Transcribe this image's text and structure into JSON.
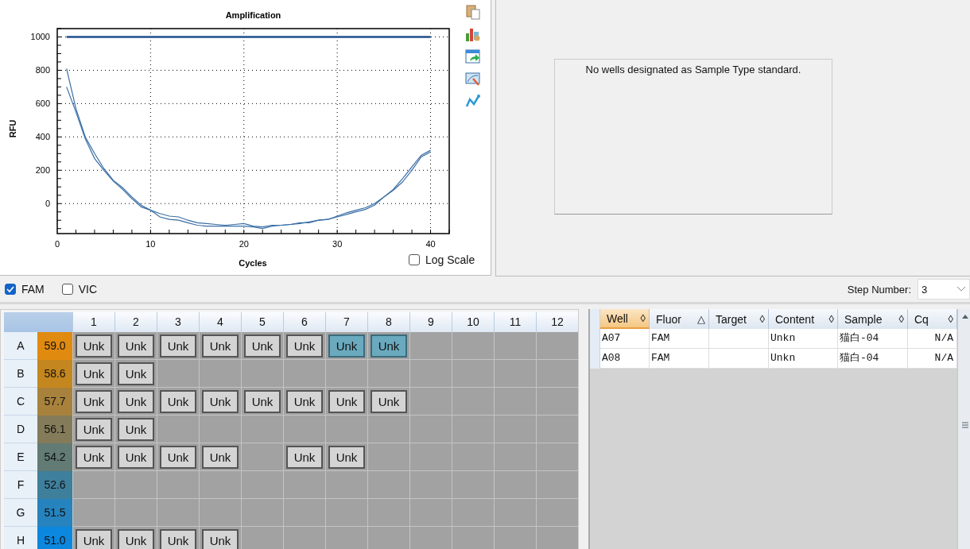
{
  "chart_panel": {
    "chart_data": {
      "type": "line",
      "grid": true,
      "title": "Amplification",
      "xlabel": "Cycles",
      "ylabel": "RFU",
      "xlim": [
        0,
        42
      ],
      "ylim": [
        -180,
        1050
      ],
      "xticks": [
        0,
        10,
        20,
        30,
        40
      ],
      "yticks": [
        0,
        200,
        400,
        600,
        800,
        1000
      ],
      "x": [
        1,
        2,
        3,
        4,
        5,
        6,
        7,
        8,
        9,
        10,
        11,
        12,
        13,
        14,
        15,
        16,
        17,
        18,
        19,
        20,
        21,
        22,
        23,
        24,
        25,
        26,
        27,
        28,
        29,
        30,
        31,
        32,
        33,
        34,
        35,
        36,
        37,
        38,
        39,
        40
      ],
      "series": [
        {
          "color": "#1f4e8c",
          "values": [
            1000,
            1000,
            1000,
            1000,
            1000,
            1000,
            1000,
            1000,
            1000,
            1000,
            1000,
            1000,
            1000,
            1000,
            1000,
            1000,
            1000,
            1000,
            1000,
            1000,
            1000,
            1000,
            1000,
            1000,
            1000,
            1000,
            1000,
            1000,
            1000,
            1000,
            1000,
            1000,
            1000,
            1000,
            1000,
            1000,
            1000,
            1000,
            1000,
            1000
          ]
        },
        {
          "color": "#3a6ea5",
          "values": [
            810,
            570,
            400,
            300,
            210,
            140,
            95,
            40,
            -10,
            -40,
            -80,
            -95,
            -100,
            -115,
            -130,
            -135,
            -135,
            -135,
            -135,
            -135,
            -140,
            -150,
            -135,
            -130,
            -125,
            -115,
            -115,
            -100,
            -95,
            -75,
            -55,
            -40,
            -25,
            0,
            40,
            80,
            130,
            200,
            280,
            310
          ]
        },
        {
          "color": "#3a6ea5",
          "values": [
            700,
            550,
            390,
            270,
            200,
            135,
            85,
            30,
            -20,
            -40,
            -60,
            -75,
            -80,
            -100,
            -115,
            -120,
            -125,
            -130,
            -125,
            -120,
            -135,
            -140,
            -130,
            -130,
            -125,
            -120,
            -110,
            -100,
            -95,
            -80,
            -65,
            -50,
            -35,
            -10,
            40,
            85,
            150,
            220,
            290,
            320
          ]
        }
      ]
    },
    "log_scale": {
      "label": "Log Scale",
      "checked": false
    }
  },
  "standard_panel": {
    "message": "No wells designated as Sample Type standard."
  },
  "fluors": [
    {
      "label": "FAM",
      "checked": true
    },
    {
      "label": "VIC",
      "checked": false
    }
  ],
  "step": {
    "label": "Step Number:",
    "value": "3"
  },
  "plate": {
    "columns": [
      "1",
      "2",
      "3",
      "4",
      "5",
      "6",
      "7",
      "8",
      "9",
      "10",
      "11",
      "12"
    ],
    "rows": [
      {
        "label": "A",
        "temp": "59.0",
        "color": "#e08a10",
        "wells": [
          {
            "kind": "well",
            "label": "Unk",
            "selected": false
          },
          {
            "kind": "well",
            "label": "Unk",
            "selected": false
          },
          {
            "kind": "well",
            "label": "Unk",
            "selected": false
          },
          {
            "kind": "well",
            "label": "Unk",
            "selected": false
          },
          {
            "kind": "well",
            "label": "Unk",
            "selected": false
          },
          {
            "kind": "well",
            "label": "Unk",
            "selected": false
          },
          {
            "kind": "well",
            "label": "Unk",
            "selected": true
          },
          {
            "kind": "well",
            "label": "Unk",
            "selected": true
          },
          {
            "kind": "empty",
            "selected": false
          },
          {
            "kind": "empty",
            "selected": false
          },
          {
            "kind": "empty",
            "selected": false
          },
          {
            "kind": "empty",
            "selected": false
          }
        ]
      },
      {
        "label": "B",
        "temp": "58.6",
        "color": "#c4861e",
        "wells": [
          {
            "kind": "well",
            "label": "Unk",
            "selected": false
          },
          {
            "kind": "well",
            "label": "Unk",
            "selected": false
          },
          {
            "kind": "empty",
            "selected": false
          },
          {
            "kind": "empty",
            "selected": false
          },
          {
            "kind": "empty",
            "selected": false
          },
          {
            "kind": "empty",
            "selected": false
          },
          {
            "kind": "empty",
            "selected": false
          },
          {
            "kind": "empty",
            "selected": false
          },
          {
            "kind": "empty",
            "selected": false
          },
          {
            "kind": "empty",
            "selected": false
          },
          {
            "kind": "empty",
            "selected": false
          },
          {
            "kind": "empty",
            "selected": false
          }
        ]
      },
      {
        "label": "C",
        "temp": "57.7",
        "color": "#a8823c",
        "wells": [
          {
            "kind": "well",
            "label": "Unk",
            "selected": false
          },
          {
            "kind": "well",
            "label": "Unk",
            "selected": false
          },
          {
            "kind": "well",
            "label": "Unk",
            "selected": false
          },
          {
            "kind": "well",
            "label": "Unk",
            "selected": false
          },
          {
            "kind": "well",
            "label": "Unk",
            "selected": false
          },
          {
            "kind": "well",
            "label": "Unk",
            "selected": false
          },
          {
            "kind": "well",
            "label": "Unk",
            "selected": false
          },
          {
            "kind": "well",
            "label": "Unk",
            "selected": false
          },
          {
            "kind": "empty",
            "selected": false
          },
          {
            "kind": "empty",
            "selected": false
          },
          {
            "kind": "empty",
            "selected": false
          },
          {
            "kind": "empty",
            "selected": false
          }
        ]
      },
      {
        "label": "D",
        "temp": "56.1",
        "color": "#847b5a",
        "wells": [
          {
            "kind": "well",
            "label": "Unk",
            "selected": false
          },
          {
            "kind": "well",
            "label": "Unk",
            "selected": false
          },
          {
            "kind": "empty",
            "selected": false
          },
          {
            "kind": "empty",
            "selected": false
          },
          {
            "kind": "empty",
            "selected": false
          },
          {
            "kind": "empty",
            "selected": false
          },
          {
            "kind": "empty",
            "selected": false
          },
          {
            "kind": "empty",
            "selected": false
          },
          {
            "kind": "empty",
            "selected": false
          },
          {
            "kind": "empty",
            "selected": false
          },
          {
            "kind": "empty",
            "selected": false
          },
          {
            "kind": "empty",
            "selected": false
          }
        ]
      },
      {
        "label": "E",
        "temp": "54.2",
        "color": "#627b74",
        "wells": [
          {
            "kind": "well",
            "label": "Unk",
            "selected": false
          },
          {
            "kind": "well",
            "label": "Unk",
            "selected": false
          },
          {
            "kind": "well",
            "label": "Unk",
            "selected": false
          },
          {
            "kind": "well",
            "label": "Unk",
            "selected": false
          },
          {
            "kind": "empty",
            "selected": false
          },
          {
            "kind": "well",
            "label": "Unk",
            "selected": false
          },
          {
            "kind": "well",
            "label": "Unk",
            "selected": false
          },
          {
            "kind": "empty",
            "selected": false
          },
          {
            "kind": "empty",
            "selected": false
          },
          {
            "kind": "empty",
            "selected": false
          },
          {
            "kind": "empty",
            "selected": false
          },
          {
            "kind": "empty",
            "selected": false
          }
        ]
      },
      {
        "label": "F",
        "temp": "52.6",
        "color": "#3e7f9c",
        "wells": [
          {
            "kind": "empty",
            "selected": false
          },
          {
            "kind": "empty",
            "selected": false
          },
          {
            "kind": "empty",
            "selected": false
          },
          {
            "kind": "empty",
            "selected": false
          },
          {
            "kind": "empty",
            "selected": false
          },
          {
            "kind": "empty",
            "selected": false
          },
          {
            "kind": "empty",
            "selected": false
          },
          {
            "kind": "empty",
            "selected": false
          },
          {
            "kind": "empty",
            "selected": false
          },
          {
            "kind": "empty",
            "selected": false
          },
          {
            "kind": "empty",
            "selected": false
          },
          {
            "kind": "empty",
            "selected": false
          }
        ]
      },
      {
        "label": "G",
        "temp": "51.5",
        "color": "#2683bd",
        "wells": [
          {
            "kind": "empty",
            "selected": false
          },
          {
            "kind": "empty",
            "selected": false
          },
          {
            "kind": "empty",
            "selected": false
          },
          {
            "kind": "empty",
            "selected": false
          },
          {
            "kind": "empty",
            "selected": false
          },
          {
            "kind": "empty",
            "selected": false
          },
          {
            "kind": "empty",
            "selected": false
          },
          {
            "kind": "empty",
            "selected": false
          },
          {
            "kind": "empty",
            "selected": false
          },
          {
            "kind": "empty",
            "selected": false
          },
          {
            "kind": "empty",
            "selected": false
          },
          {
            "kind": "empty",
            "selected": false
          }
        ]
      },
      {
        "label": "H",
        "temp": "51.0",
        "color": "#0c87de",
        "wells": [
          {
            "kind": "well",
            "label": "Unk",
            "selected": false
          },
          {
            "kind": "well",
            "label": "Unk",
            "selected": false
          },
          {
            "kind": "well",
            "label": "Unk",
            "selected": false
          },
          {
            "kind": "well",
            "label": "Unk",
            "selected": false
          },
          {
            "kind": "empty",
            "selected": false
          },
          {
            "kind": "empty",
            "selected": false
          },
          {
            "kind": "empty",
            "selected": false
          },
          {
            "kind": "empty",
            "selected": false
          },
          {
            "kind": "empty",
            "selected": false
          },
          {
            "kind": "empty",
            "selected": false
          },
          {
            "kind": "empty",
            "selected": false
          },
          {
            "kind": "empty",
            "selected": false
          }
        ]
      }
    ]
  },
  "results_table": {
    "columns": [
      {
        "label": "Well",
        "sort_icon": "◊",
        "selected": true
      },
      {
        "label": "Fluor",
        "sort_icon": "△",
        "selected": false
      },
      {
        "label": "Target",
        "sort_icon": "◊",
        "selected": false
      },
      {
        "label": "Content",
        "sort_icon": "◊",
        "selected": false
      },
      {
        "label": "Sample",
        "sort_icon": "◊",
        "selected": false
      },
      {
        "label": "Cq",
        "sort_icon": "◊",
        "selected": false
      }
    ],
    "rows": [
      [
        "A07",
        "FAM",
        "",
        "Unkn",
        "猫白-04",
        "N/A"
      ],
      [
        "A08",
        "FAM",
        "",
        "Unkn",
        "猫白-04",
        "N/A"
      ]
    ]
  }
}
